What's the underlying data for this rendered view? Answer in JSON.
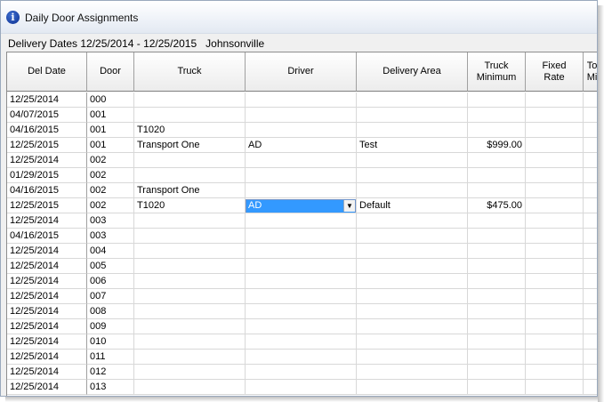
{
  "window": {
    "title": "Daily Door Assignments",
    "icon": "info-icon"
  },
  "info_bar": "Delivery Dates 12/25/2014 - 12/25/2015   Johnsonville",
  "grid": {
    "columns": [
      "Del Date",
      "Door",
      "Truck",
      "Driver",
      "Delivery Area",
      "Truck\nMinimum",
      "Fixed\nRate",
      "To\nMi"
    ],
    "rows": [
      [
        "12/25/2014",
        "000",
        "",
        "",
        "",
        "",
        "",
        ""
      ],
      [
        "04/07/2015",
        "001",
        "",
        "",
        "",
        "",
        "",
        ""
      ],
      [
        "04/16/2015",
        "001",
        "T1020",
        "",
        "",
        "",
        "",
        ""
      ],
      [
        "12/25/2015",
        "001",
        "Transport One",
        "AD",
        "Test",
        "$999.00",
        "",
        ""
      ],
      [
        "12/25/2014",
        "002",
        "",
        "",
        "",
        "",
        "",
        ""
      ],
      [
        "01/29/2015",
        "002",
        "",
        "",
        "",
        "",
        "",
        ""
      ],
      [
        "04/16/2015",
        "002",
        "Transport One",
        "",
        "",
        "",
        "",
        ""
      ],
      [
        "12/25/2015",
        "002",
        "T1020",
        "AD",
        "Default",
        "$475.00",
        "",
        ""
      ],
      [
        "12/25/2014",
        "003",
        "",
        "",
        "",
        "",
        "",
        ""
      ],
      [
        "04/16/2015",
        "003",
        "",
        "",
        "",
        "",
        "",
        ""
      ],
      [
        "12/25/2014",
        "004",
        "",
        "",
        "",
        "",
        "",
        ""
      ],
      [
        "12/25/2014",
        "005",
        "",
        "",
        "",
        "",
        "",
        ""
      ],
      [
        "12/25/2014",
        "006",
        "",
        "",
        "",
        "",
        "",
        ""
      ],
      [
        "12/25/2014",
        "007",
        "",
        "",
        "",
        "",
        "",
        ""
      ],
      [
        "12/25/2014",
        "008",
        "",
        "",
        "",
        "",
        "",
        ""
      ],
      [
        "12/25/2014",
        "009",
        "",
        "",
        "",
        "",
        "",
        ""
      ],
      [
        "12/25/2014",
        "010",
        "",
        "",
        "",
        "",
        "",
        ""
      ],
      [
        "12/25/2014",
        "011",
        "",
        "",
        "",
        "",
        "",
        ""
      ],
      [
        "12/25/2014",
        "012",
        "",
        "",
        "",
        "",
        "",
        ""
      ],
      [
        "12/25/2014",
        "013",
        "",
        "",
        "",
        "",
        "",
        ""
      ]
    ],
    "active_editor": {
      "row": 7,
      "column": 3,
      "value": "AD",
      "icon": "dropdown-arrow-icon"
    }
  },
  "colors": {
    "selection": "#3399ff",
    "title_gradient_end": "#e3e9f2"
  }
}
